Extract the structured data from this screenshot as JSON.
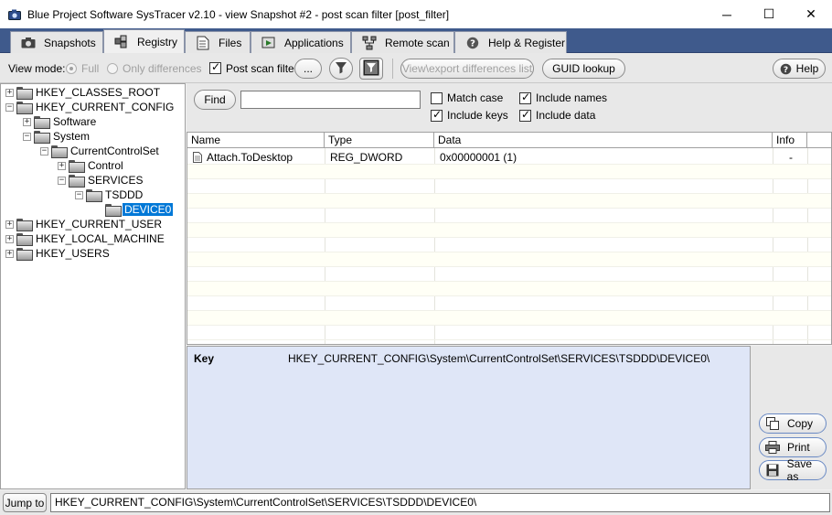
{
  "window": {
    "title": "Blue Project Software SysTracer v2.10 - view Snapshot #2 - post scan filter [post_filter]",
    "minimize": "─",
    "maximize": "☐",
    "close": "✕"
  },
  "tabs": [
    {
      "label": "Snapshots",
      "icon": "camera-icon"
    },
    {
      "label": "Registry",
      "icon": "registry-icon"
    },
    {
      "label": "Files",
      "icon": "files-icon"
    },
    {
      "label": "Applications",
      "icon": "applications-icon"
    },
    {
      "label": "Remote scan",
      "icon": "network-icon"
    },
    {
      "label": "Help & Register",
      "icon": "help-icon"
    }
  ],
  "toolbar": {
    "view_mode_label": "View mode:",
    "full_label": "Full",
    "only_differences_label": "Only differences",
    "post_scan_filter_label": "Post scan filter",
    "ellipsis_label": "...",
    "view_export_label": "View\\export differences list",
    "guid_lookup_label": "GUID lookup",
    "help_label": "Help"
  },
  "tree": [
    {
      "label": "HKEY_CLASSES_ROOT",
      "expander": "+"
    },
    {
      "label": "HKEY_CURRENT_CONFIG",
      "expander": "−"
    },
    {
      "label": "Software",
      "expander": "+"
    },
    {
      "label": "System",
      "expander": "−"
    },
    {
      "label": "CurrentControlSet",
      "expander": "−"
    },
    {
      "label": "Control",
      "expander": "+"
    },
    {
      "label": "SERVICES",
      "expander": "−"
    },
    {
      "label": "TSDDD",
      "expander": "−"
    },
    {
      "label": "DEVICE0",
      "expander": ""
    },
    {
      "label": "HKEY_CURRENT_USER",
      "expander": "+"
    },
    {
      "label": "HKEY_LOCAL_MACHINE",
      "expander": "+"
    },
    {
      "label": "HKEY_USERS",
      "expander": "+"
    }
  ],
  "find": {
    "button_label": "Find",
    "input_value": "",
    "match_case_label": "Match case",
    "include_keys_label": "Include keys",
    "include_names_label": "Include names",
    "include_data_label": "Include data"
  },
  "grid": {
    "headers": [
      "Name",
      "Type",
      "Data",
      "Info"
    ],
    "rows": [
      {
        "name": "Attach.ToDesktop",
        "type": "REG_DWORD",
        "data": "0x00000001 (1)",
        "info": "-"
      }
    ]
  },
  "key_panel": {
    "label": "Key",
    "value": "HKEY_CURRENT_CONFIG\\System\\CurrentControlSet\\SERVICES\\TSDDD\\DEVICE0\\"
  },
  "side_buttons": {
    "copy_label": "Copy",
    "print_label": "Print",
    "save_label": "Save as"
  },
  "status": {
    "jump_label": "Jump to",
    "path": "HKEY_CURRENT_CONFIG\\System\\CurrentControlSet\\SERVICES\\TSDDD\\DEVICE0\\"
  }
}
